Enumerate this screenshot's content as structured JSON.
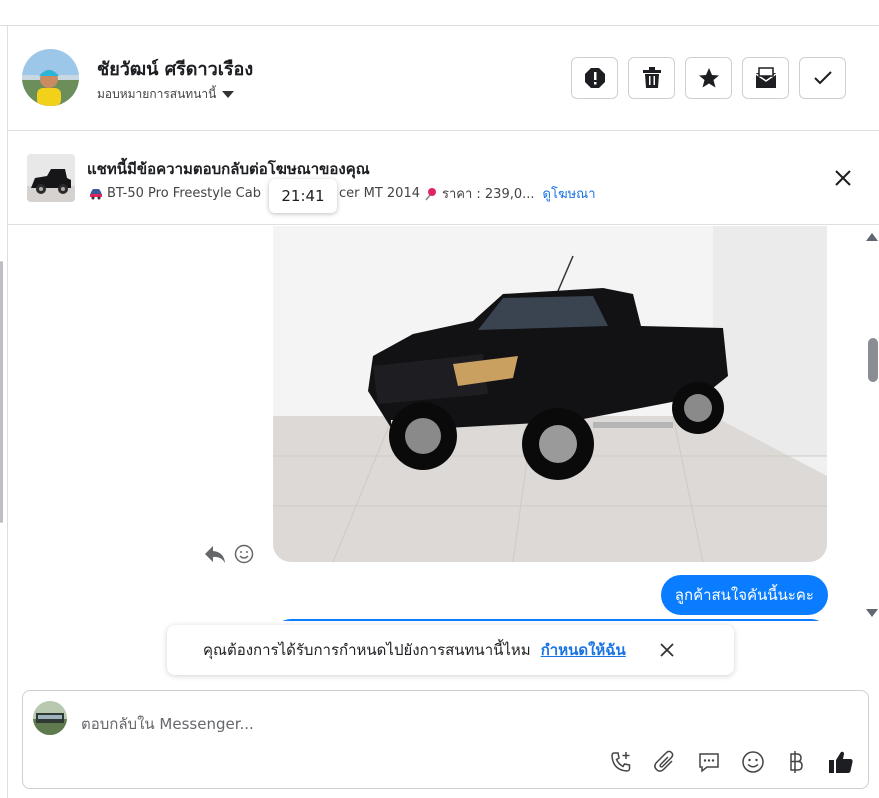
{
  "contact": {
    "name": "ชัยวัฒน์ ศรีดาวเรือง",
    "assign_label": "มอบหมายการสนทนานี้"
  },
  "actions": [
    {
      "name": "report-icon"
    },
    {
      "name": "trash-icon"
    },
    {
      "name": "star-icon"
    },
    {
      "name": "mark-unread-icon"
    },
    {
      "name": "checkmark-icon"
    }
  ],
  "ad": {
    "title": "แชทนี้มีข้อความตอบกลับต่อโฆษณาของคุณ",
    "product_part1": "BT-50 Pro Freestyle Cab",
    "product_part2": "cer MT 2014",
    "price": "ราคา : 239,0...",
    "link_label": "ดูโฆษณา"
  },
  "tooltip_time": "21:41",
  "messages": [
    {
      "type": "image",
      "alt": "black Mazda pickup truck"
    },
    {
      "type": "text",
      "text": "ลูกค้าสนใจคันนี้นะคะ",
      "outgoing": true
    }
  ],
  "assign_banner": {
    "text": "คุณต้องการได้รับการกำหนดไปยังการสนทนานี้ไหม",
    "link": "กำหนดให้ฉัน"
  },
  "composer": {
    "placeholder": "ตอบกลับใน Messenger...",
    "tools": [
      "call-add-icon",
      "attachment-icon",
      "saved-reply-icon",
      "emoji-icon",
      "baht-icon",
      "thumbs-up-icon"
    ]
  },
  "colors": {
    "accent": "#0a7cff",
    "link": "#1b74e4"
  }
}
